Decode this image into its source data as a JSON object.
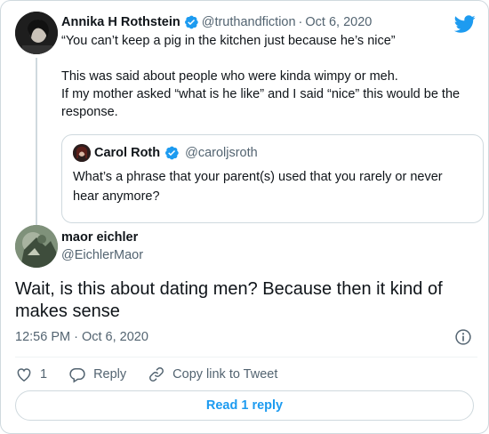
{
  "colors": {
    "accent": "#1d9bf0",
    "secondary_text": "#536471",
    "border": "#cfd9de",
    "verified": "#1d9bf0"
  },
  "parent_tweet": {
    "name": "Annika H Rothstein",
    "handle": "@truthandfiction",
    "separator": "·",
    "date": "Oct 6, 2020",
    "lines": [
      "“You can’t keep a pig in the kitchen just because he’s nice”",
      "",
      "This was said about people who were kinda wimpy or meh.",
      "If my mother asked “what is he like” and I said “nice” this would be the",
      "response."
    ]
  },
  "quoted_tweet": {
    "name": "Carol Roth",
    "handle": "@caroljsroth",
    "text_lines": [
      "What’s a phrase that your parent(s) used that you rarely or never",
      "hear anymore?"
    ]
  },
  "main_tweet": {
    "name": "maor eichler",
    "handle": "@EichlerMaor",
    "text_lines": [
      "Wait, is this about dating men? Because then it kind of",
      "makes sense"
    ],
    "timestamp": "12:56 PM · Oct 6, 2020"
  },
  "actions": {
    "like_count": "1",
    "reply_label": "Reply",
    "copy_label": "Copy link to Tweet"
  },
  "read_replies_label": "Read 1 reply",
  "icons": [
    "twitter-bird-icon",
    "verified-badge-icon",
    "info-icon",
    "heart-icon",
    "reply-icon",
    "link-icon"
  ]
}
